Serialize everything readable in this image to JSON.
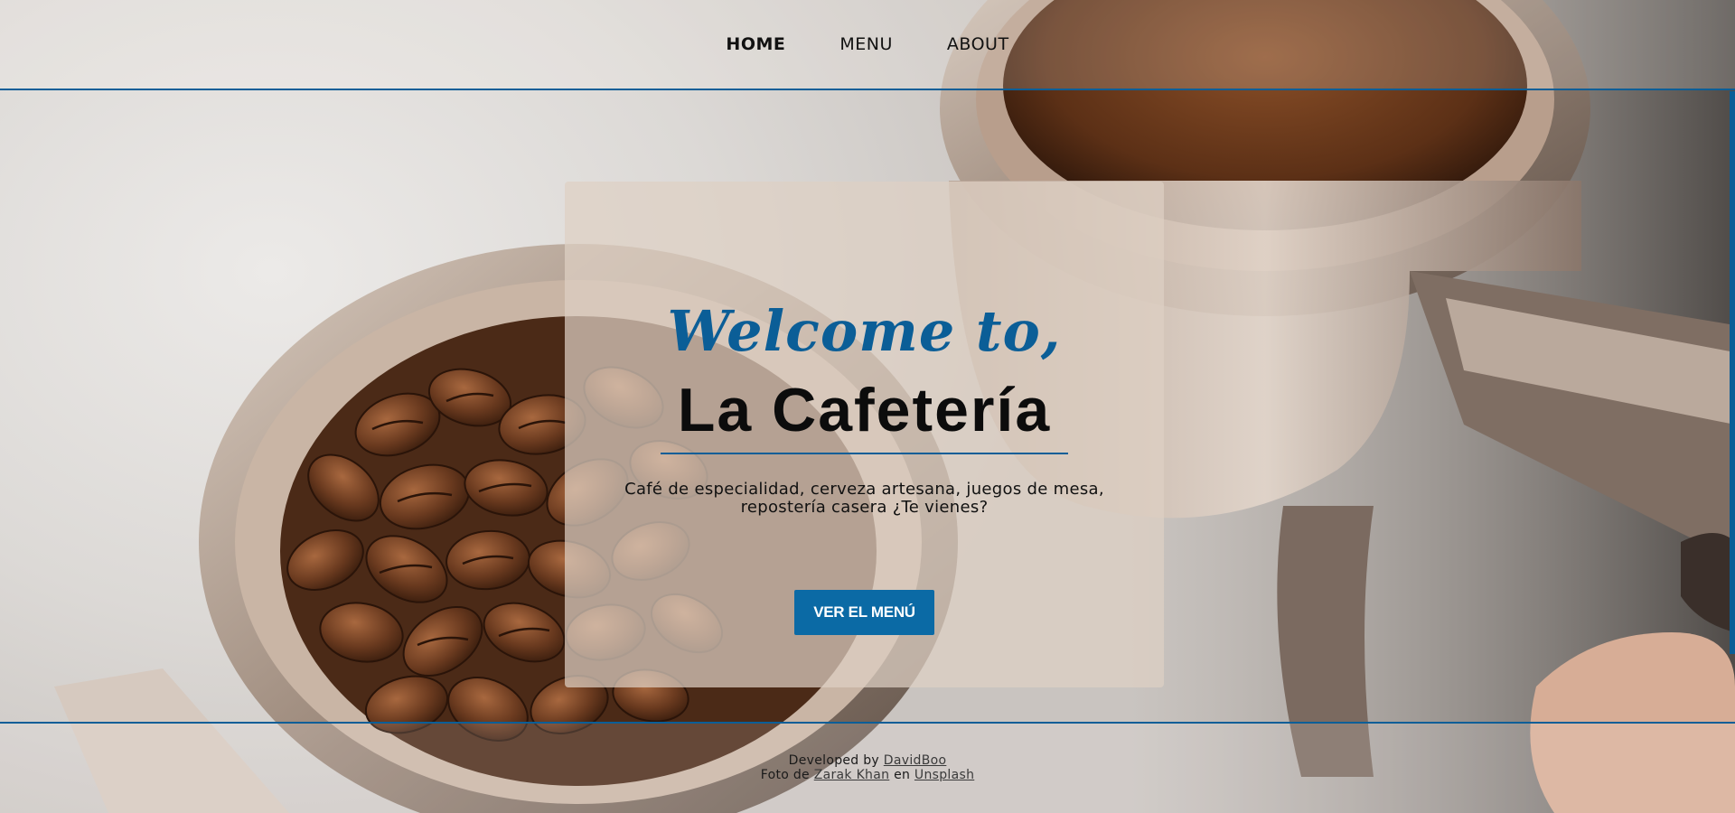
{
  "nav": {
    "items": [
      {
        "label": "HOME",
        "active": true
      },
      {
        "label": "MENU",
        "active": false
      },
      {
        "label": "ABOUT",
        "active": false
      }
    ]
  },
  "hero": {
    "welcome": "Welcome to,",
    "title": "La Cafetería",
    "tagline": "Café de especialidad, cerveza artesana, juegos de mesa, repostería casera ¿Te vienes?",
    "cta_label": "VER EL MENÚ"
  },
  "footer": {
    "developed_prefix": "Developed by",
    "developer_link": "DavidBoo",
    "photo_prefix": "Foto de",
    "photographer_link": "Zarak Khan",
    "photo_middle": "en",
    "source_link": "Unsplash"
  },
  "colors": {
    "accent": "#0b5e97",
    "button": "#0b6aa5",
    "card": "#ded0c4"
  },
  "background": {
    "description_icon": "coffee-portafilter-photo"
  }
}
